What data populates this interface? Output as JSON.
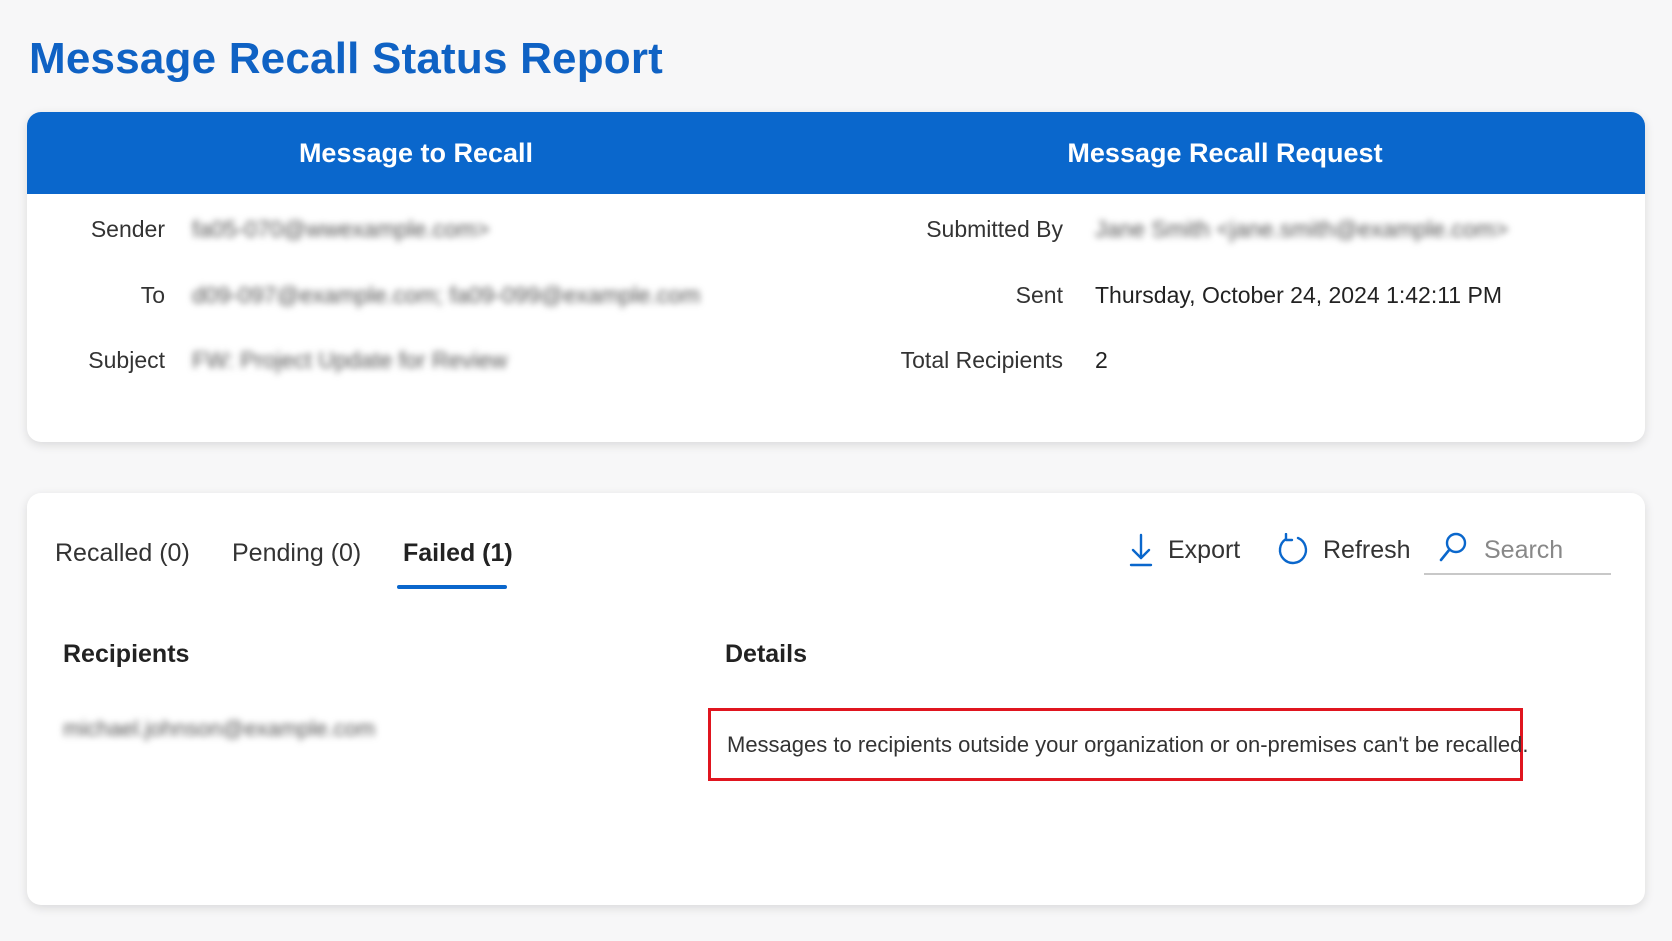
{
  "page": {
    "title": "Message Recall Status Report"
  },
  "summary": {
    "left_header": "Message to Recall",
    "right_header": "Message Recall Request",
    "sender_label": "Sender",
    "sender_value": "fa05-070@wwexample.com>",
    "to_label": "To",
    "to_value": "d09-097@example.com; fa09-099@example.com",
    "subject_label": "Subject",
    "subject_value": "FW: Project Update for Review",
    "submitted_by_label": "Submitted By",
    "submitted_by_value": "Jane Smith <jane.smith@example.com>",
    "sent_label": "Sent",
    "sent_value": "Thursday, October 24, 2024 1:42:11 PM",
    "total_recipients_label": "Total Recipients",
    "total_recipients_value": "2"
  },
  "status": {
    "tabs": [
      {
        "label": "Recalled (0)",
        "active": false
      },
      {
        "label": "Pending (0)",
        "active": false
      },
      {
        "label": "Failed (1)",
        "active": true
      }
    ],
    "export_label": "Export",
    "refresh_label": "Refresh",
    "search_placeholder": "Search",
    "columns": {
      "recipients": "Recipients",
      "details": "Details"
    },
    "rows": [
      {
        "recipient": "michael.johnson@example.com",
        "details": "Messages to recipients outside your organization or on-premises can't be recalled."
      }
    ]
  },
  "colors": {
    "title": "#0f62c4",
    "header_bg": "#0a67cc",
    "highlight_border": "#e0151f"
  },
  "icons": [
    "download-icon",
    "refresh-icon",
    "search-icon"
  ]
}
